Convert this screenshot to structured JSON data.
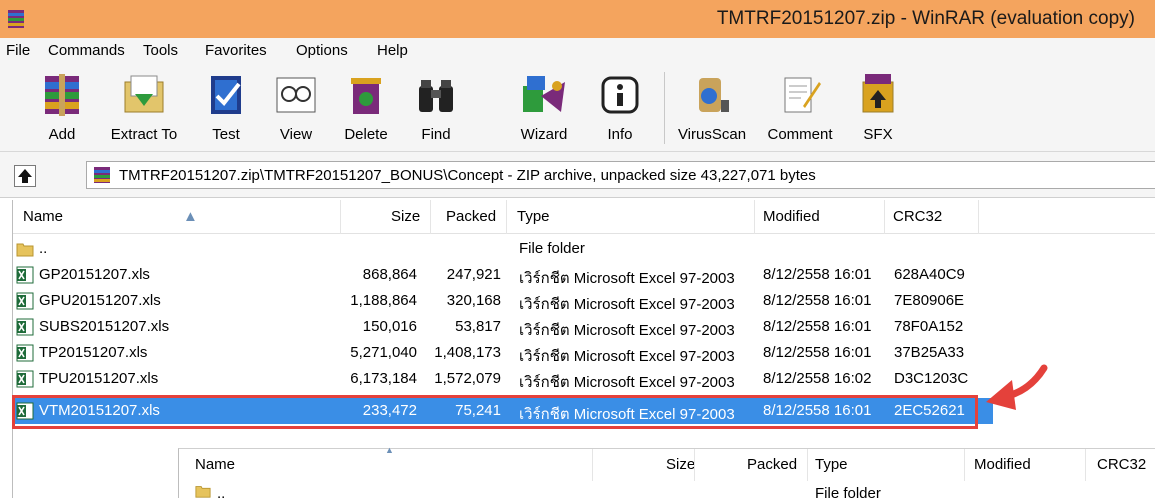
{
  "window": {
    "title": "TMTRF20151207.zip - WinRAR (evaluation copy)"
  },
  "menu": [
    "File",
    "Commands",
    "Tools",
    "Favorites",
    "Options",
    "Help"
  ],
  "toolbar": [
    {
      "label": "Add",
      "icon": "add-archive-icon"
    },
    {
      "label": "Extract To",
      "icon": "extract-to-icon"
    },
    {
      "label": "Test",
      "icon": "test-archive-icon"
    },
    {
      "label": "View",
      "icon": "view-file-icon"
    },
    {
      "label": "Delete",
      "icon": "delete-recycle-icon"
    },
    {
      "label": "Find",
      "icon": "binoculars-icon"
    },
    {
      "label": "Wizard",
      "icon": "wizard-icon"
    },
    {
      "label": "Info",
      "icon": "info-icon"
    },
    {
      "label": "VirusScan",
      "icon": "virus-scan-icon"
    },
    {
      "label": "Comment",
      "icon": "comment-icon"
    },
    {
      "label": "SFX",
      "icon": "sfx-icon"
    }
  ],
  "address": {
    "path": "TMTRF20151207.zip\\TMTRF20151207_BONUS\\Concept - ZIP archive, unpacked size 43,227,071 bytes"
  },
  "columns": {
    "name": "Name",
    "size": "Size",
    "packed": "Packed",
    "type": "Type",
    "modified": "Modified",
    "crc": "CRC32"
  },
  "files": [
    {
      "name": "..",
      "size": "",
      "packed": "",
      "type": "File folder",
      "modified": "",
      "crc": "",
      "kind": "folder"
    },
    {
      "name": "GP20151207.xls",
      "size": "868,864",
      "packed": "247,921",
      "type": "เวิร์กชีต Microsoft Excel 97-2003",
      "modified": "8/12/2558 16:01",
      "crc": "628A40C9",
      "kind": "excel"
    },
    {
      "name": "GPU20151207.xls",
      "size": "1,188,864",
      "packed": "320,168",
      "type": "เวิร์กชีต Microsoft Excel 97-2003",
      "modified": "8/12/2558 16:01",
      "crc": "7E80906E",
      "kind": "excel"
    },
    {
      "name": "SUBS20151207.xls",
      "size": "150,016",
      "packed": "53,817",
      "type": "เวิร์กชีต Microsoft Excel 97-2003",
      "modified": "8/12/2558 16:01",
      "crc": "78F0A152",
      "kind": "excel"
    },
    {
      "name": "TP20151207.xls",
      "size": "5,271,040",
      "packed": "1,408,173",
      "type": "เวิร์กชีต Microsoft Excel 97-2003",
      "modified": "8/12/2558 16:01",
      "crc": "37B25A33",
      "kind": "excel"
    },
    {
      "name": "TPU20151207.xls",
      "size": "6,173,184",
      "packed": "1,572,079",
      "type": "เวิร์กชีต Microsoft Excel 97-2003",
      "modified": "8/12/2558 16:02",
      "crc": "D3C1203C",
      "kind": "excel"
    },
    {
      "name": "VTM20151207.xls",
      "size": "233,472",
      "packed": "75,241",
      "type": "เวิร์กชีต Microsoft Excel 97-2003",
      "modified": "8/12/2558 16:01",
      "crc": "2EC52621",
      "kind": "excel",
      "selected": true
    }
  ],
  "second_panel": {
    "columns": {
      "name": "Name",
      "size": "Size",
      "packed": "Packed",
      "type": "Type",
      "modified": "Modified",
      "crc": "CRC32"
    },
    "first_row": {
      "name": "..",
      "type": "File folder"
    }
  },
  "colors": {
    "titlebar": "#f4a45e",
    "selection": "#3a8ee6",
    "highlight_outline": "#e4413b",
    "arrow": "#e4413b"
  }
}
